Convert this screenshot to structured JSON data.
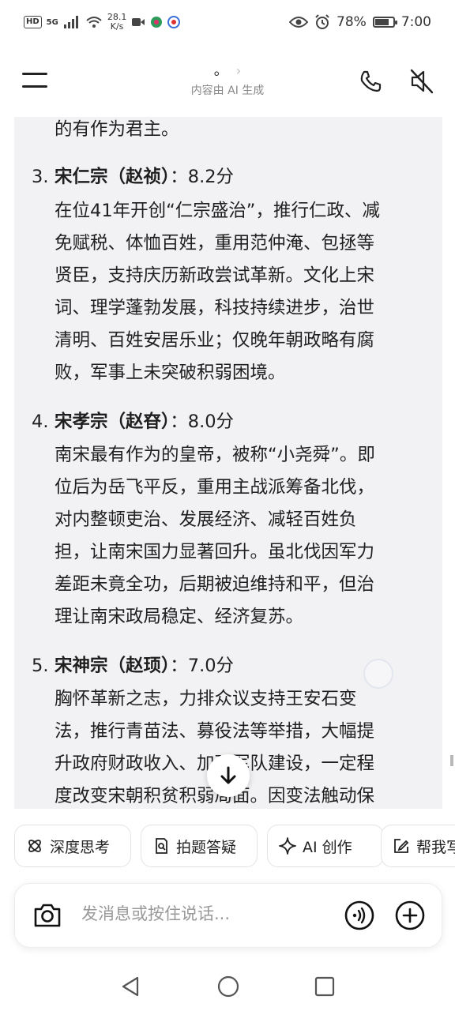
{
  "status_bar": {
    "badge": "HD",
    "network": "5G",
    "speed_value": "28.1",
    "speed_unit": "K/s",
    "battery_percent": "78%",
    "battery_level": 0.78,
    "time": "7:00"
  },
  "header": {
    "title": "。",
    "subtitle": "内容由 AI 生成"
  },
  "message": {
    "lines": [
      {
        "num": "",
        "bold": "",
        "text": "的有作为君主。"
      },
      {
        "num": "3.",
        "bold": "宋仁宗（赵祯）",
        "text": "：8.2分"
      },
      {
        "num": "",
        "bold": "",
        "text": "在位41年开创“仁宗盛治”，推行仁政、减"
      },
      {
        "num": "",
        "bold": "",
        "text": "免赋税、体恤百姓，重用范仲淹、包拯等"
      },
      {
        "num": "",
        "bold": "",
        "text": "贤臣，支持庆历新政尝试革新。文化上宋"
      },
      {
        "num": "",
        "bold": "",
        "text": "词、理学蓬勃发展，科技持续进步，治世"
      },
      {
        "num": "",
        "bold": "",
        "text": "清明、百姓安居乐业；仅晚年朝政略有腐"
      },
      {
        "num": "",
        "bold": "",
        "text": "败，军事上未突破积弱困境。"
      },
      {
        "num": "4.",
        "bold": "宋孝宗（赵昚）",
        "text": "：8.0分"
      },
      {
        "num": "",
        "bold": "",
        "text": "南宋最有作为的皇帝，被称“小尧舜”。即"
      },
      {
        "num": "",
        "bold": "",
        "text": "位后为岳飞平反，重用主战派筹备北伐，"
      },
      {
        "num": "",
        "bold": "",
        "text": "对内整顿吏治、发展经济、减轻百姓负"
      },
      {
        "num": "",
        "bold": "",
        "text": "担，让南宋国力显著回升。虽北伐因军力"
      },
      {
        "num": "",
        "bold": "",
        "text": "差距未竟全功，后期被迫维持和平，但治"
      },
      {
        "num": "",
        "bold": "",
        "text": "理让南宋政局稳定、经济复苏。"
      },
      {
        "num": "5.",
        "bold": "宋神宗（赵顼）",
        "text": "：7.0分"
      },
      {
        "num": "",
        "bold": "",
        "text": "胸怀革新之志，力排众议支持王安石变"
      },
      {
        "num": "",
        "bold": "",
        "text": "法，推行青苗法、募役法等举措，大幅提"
      },
      {
        "num": "",
        "bold": "",
        "text": "升政府财政收入、加强军队建设，一定程"
      },
      {
        "num": "",
        "bold": "",
        "text": "度改变宋朝积贫积弱局面。因变法触动保"
      }
    ]
  },
  "chips": [
    {
      "label": "深度思考",
      "icon": "atom-icon"
    },
    {
      "label": "拍题答疑",
      "icon": "document-search-icon"
    },
    {
      "label": "AI 创作",
      "icon": "sparkle-icon"
    },
    {
      "label": "帮我写",
      "icon": "edit-icon"
    }
  ],
  "input": {
    "placeholder": "发消息或按住说话..."
  },
  "colors": {
    "card_bg": "#f2f2f4",
    "text": "#1f1f1f",
    "muted": "#888888"
  }
}
